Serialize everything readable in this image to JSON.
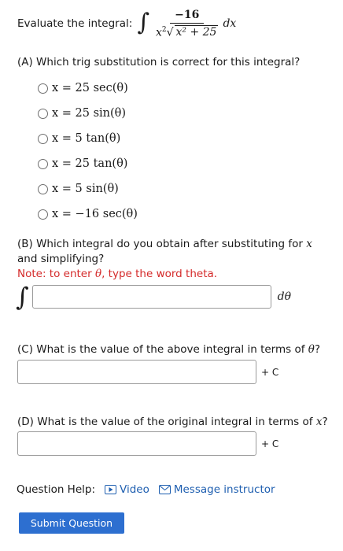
{
  "header": {
    "label": "Evaluate the integral:",
    "integrand": {
      "numerator": "−16",
      "den_x": "x",
      "den_exp": "2",
      "den_sqrt": "x² + 25",
      "dx": "dx"
    }
  },
  "partA": {
    "question": "(A) Which trig substitution is correct for this integral?",
    "options": [
      "x = 25 sec(θ)",
      "x = 25 sin(θ)",
      "x = 5 tan(θ)",
      "x = 25 tan(θ)",
      "x = 5 sin(θ)",
      "x = −16 sec(θ)"
    ]
  },
  "partB": {
    "question_pre": "(B) Which integral do you obtain after substituting for ",
    "question_var": "x",
    "question_post": " and simplifying?",
    "note_pre": "Note: to enter ",
    "note_var": "θ",
    "note_post": ", type the word theta.",
    "suffix": "dθ",
    "value": ""
  },
  "partC": {
    "question_pre": "(C) What is the value of the above integral in terms of ",
    "question_var": "θ",
    "question_post": "?",
    "suffix": "+ C",
    "value": ""
  },
  "partD": {
    "question_pre": "(D) What is the value of the original integral in terms of ",
    "question_var": "x",
    "question_post": "?",
    "suffix": "+ C",
    "value": ""
  },
  "help": {
    "label": "Question Help:",
    "video_label": "Video",
    "message_label": "Message instructor"
  },
  "submit_label": "Submit Question",
  "colors": {
    "link": "#1f5fb0",
    "note": "#d42a2a",
    "button": "#2d6fd0"
  },
  "icons": {
    "video": "video-play-icon",
    "message": "envelope-icon"
  }
}
